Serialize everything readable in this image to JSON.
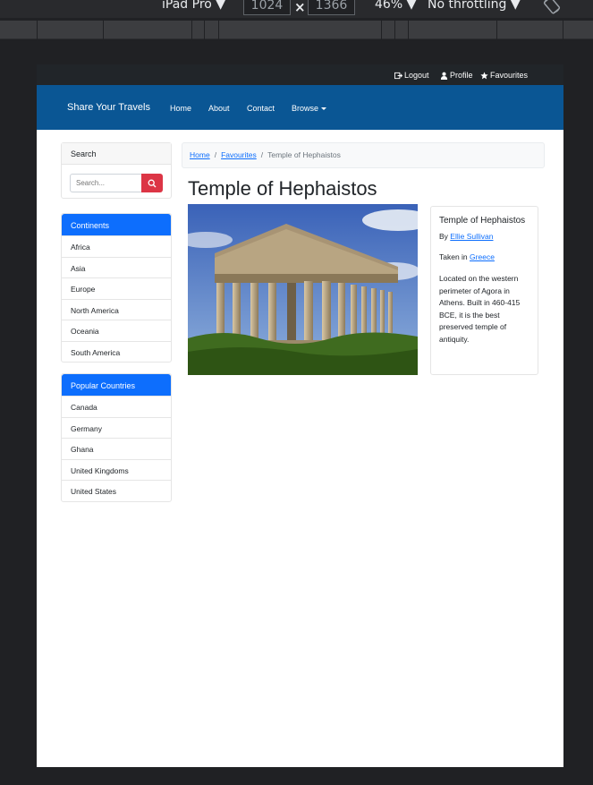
{
  "devtools": {
    "device": "iPad Pro ▼",
    "width": "1024",
    "height": "1366",
    "zoom": "46% ▼",
    "throttling": "No throttling ▼"
  },
  "topbar": {
    "logout": "Logout",
    "profile": "Profile",
    "favourites": "Favourites"
  },
  "navbar": {
    "brand": "Share Your Travels",
    "links": [
      "Home",
      "About",
      "Contact",
      "Browse"
    ]
  },
  "sidebar": {
    "search_title": "Search",
    "search_placeholder": "Search...",
    "continents_title": "Continents",
    "continents": [
      "Africa",
      "Asia",
      "Europe",
      "North America",
      "Oceania",
      "South America"
    ],
    "countries_title": "Popular Countries",
    "countries": [
      "Canada",
      "Germany",
      "Ghana",
      "United Kingdoms",
      "United States"
    ]
  },
  "breadcrumb": [
    "Home",
    "Favourites",
    "Temple of Hephaistos"
  ],
  "photo": {
    "title": "Temple of Hephaistos",
    "card_title": "Temple of Hephaistos",
    "by_label": "By",
    "author": "Ellie Sullivan",
    "taken_label": "Taken in",
    "country": "Greece",
    "description": "Located on the western perimeter of Agora in Athens. Built in 460-415 BCE, it is the best preserved temple of antiquity."
  }
}
